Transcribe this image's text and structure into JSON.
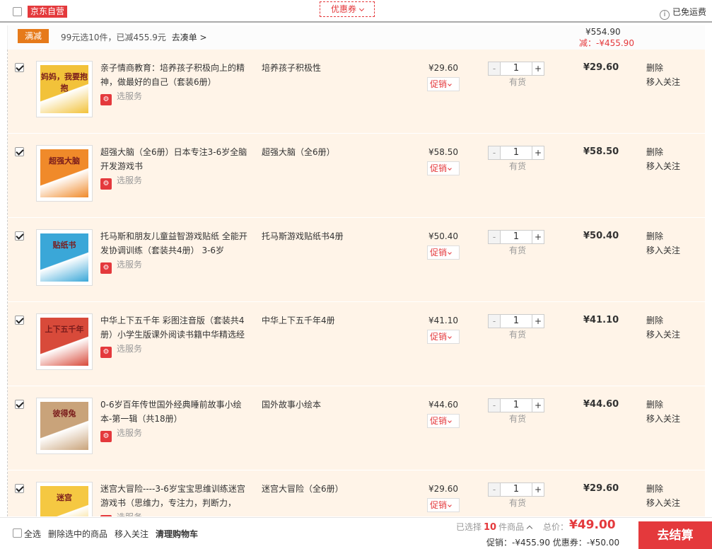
{
  "shop": {
    "tag": "京东自营",
    "coupon_label": "优惠券",
    "freeship": "已免运费",
    "info_icon": "i"
  },
  "promo": {
    "tag": "满减",
    "text": "99元选10件，已减455.9元",
    "link": "去凑单 >",
    "original_total": "¥554.90",
    "discount": "减：-¥455.90"
  },
  "items": [
    {
      "title": "亲子情商教育：培养孩子积极向上的精神，做最好的自己（套装6册）",
      "service": "选服务",
      "spec": "培养孩子积极性",
      "price": "¥29.60",
      "promo_label": "促销",
      "qty": "1",
      "minus": "-",
      "plus": "+",
      "stock": "有货",
      "sum": "¥29.60",
      "delete": "删除",
      "follow": "移入关注",
      "cover_text": "妈妈，我要抱抱",
      "cover_color": "#f2c23a"
    },
    {
      "title": "超强大脑（全6册）日本专注3-6岁全脑开发游戏书",
      "service": "选服务",
      "spec": "超强大脑（全6册）",
      "price": "¥58.50",
      "promo_label": "促销",
      "qty": "1",
      "minus": "-",
      "plus": "+",
      "stock": "有货",
      "sum": "¥58.50",
      "delete": "删除",
      "follow": "移入关注",
      "cover_text": "超强大脑",
      "cover_color": "#f08a2a"
    },
    {
      "title": "托马斯和朋友儿童益智游戏贴纸 全能开发协调训练（套装共4册） 3-6岁",
      "service": "选服务",
      "spec": "托马斯游戏贴纸书4册",
      "price": "¥50.40",
      "promo_label": "促销",
      "qty": "1",
      "minus": "-",
      "plus": "+",
      "stock": "有货",
      "sum": "¥50.40",
      "delete": "删除",
      "follow": "移入关注",
      "cover_text": "贴纸书",
      "cover_color": "#3aa7d8"
    },
    {
      "title": "中华上下五千年 彩图注音版（套装共4册）小学生版课外阅读书籍中华精选经",
      "service": "选服务",
      "spec": "中华上下五千年4册",
      "price": "¥41.10",
      "promo_label": "促销",
      "qty": "1",
      "minus": "-",
      "plus": "+",
      "stock": "有货",
      "sum": "¥41.10",
      "delete": "删除",
      "follow": "移入关注",
      "cover_text": "上下五千年",
      "cover_color": "#d84a3a"
    },
    {
      "title": "0-6岁百年传世国外经典睡前故事小绘本-第一辑（共18册）",
      "service": "选服务",
      "spec": "国外故事小绘本",
      "price": "¥44.60",
      "promo_label": "促销",
      "qty": "1",
      "minus": "-",
      "plus": "+",
      "stock": "有货",
      "sum": "¥44.60",
      "delete": "删除",
      "follow": "移入关注",
      "cover_text": "彼得兔",
      "cover_color": "#c9a37a"
    },
    {
      "title": "迷宫大冒险----3-6岁宝宝思维训练迷宫游戏书（思维力，专注力，判断力，",
      "service": "选服务",
      "spec": "迷宫大冒险（全6册）",
      "price": "¥29.60",
      "promo_label": "促销",
      "qty": "1",
      "minus": "-",
      "plus": "+",
      "stock": "有货",
      "sum": "¥29.60",
      "delete": "删除",
      "follow": "移入关注",
      "cover_text": "迷宫",
      "cover_color": "#f5c842"
    }
  ],
  "bottom": {
    "select_all": "全选",
    "delete_selected": "删除选中的商品",
    "move_follow": "移入关注",
    "clear_cart": "清理购物车",
    "selected_prefix": "已选择",
    "selected_count": "10",
    "selected_suffix": "件商品",
    "total_label": "总价：",
    "total_value": "¥49.00",
    "discount_line": "促销：-¥455.90  优惠券：-¥50.00",
    "checkout": "去结算"
  },
  "colors": {
    "accent": "#e4393c",
    "promo_tag": "#e67a1a",
    "row_bg": "#fff4e8"
  }
}
